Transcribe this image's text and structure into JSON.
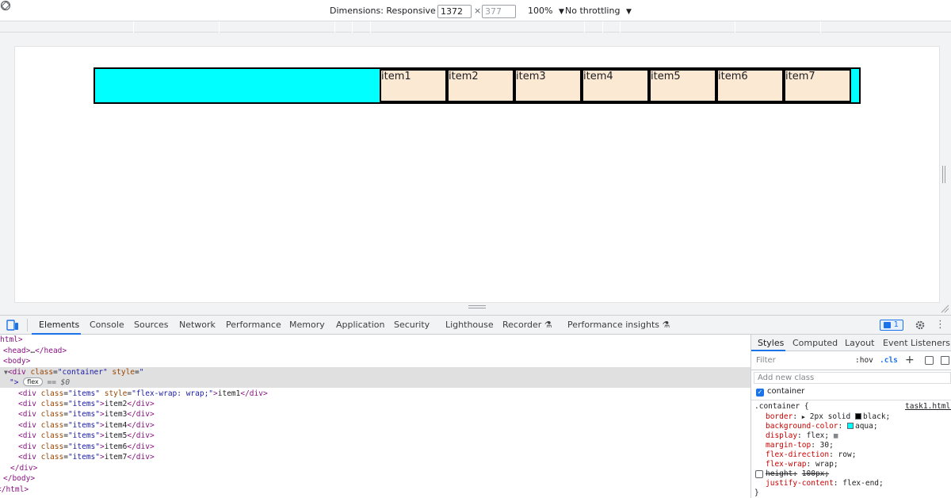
{
  "toolbar": {
    "dimensions_label": "Dimensions: Responsive",
    "width_value": "1372",
    "times": "×",
    "height_placeholder": "377",
    "zoom": "100%",
    "throttling": "No throttling",
    "caret": "▼"
  },
  "page": {
    "items": [
      "item1",
      "item2",
      "item3",
      "item4",
      "item5",
      "item6",
      "item7"
    ],
    "container_color": "#00ffff",
    "item_color": "#fbe9d4"
  },
  "devtools": {
    "tabs": [
      "Elements",
      "Console",
      "Sources",
      "Network",
      "Performance",
      "Memory",
      "Application",
      "Security",
      "Lighthouse",
      "Recorder",
      "Performance insights"
    ],
    "experimental_mark": "⚗",
    "issues_count": "1",
    "tree": {
      "l0": "html>",
      "l1_head_open": "<head>",
      "l1_head_ellipsis": "…",
      "l1_head_close": "</head>",
      "l2_body": "<body>",
      "l3_div_open": "<div ",
      "l3_attr_class": "class",
      "l3_eq1": "=",
      "l3_val_class": "\"container\"",
      "l3_attr_style": " style",
      "l3_eq2": "=",
      "l3_val_style_open": "\"",
      "l4_quote": "\">",
      "l4_badge": "flex",
      "l4_dollar": "== $0",
      "item1_open": "<div ",
      "item1_class": "class",
      "item1_classval": "\"items\"",
      "item1_style": " style",
      "item1_styleval": "\"flex-wrap: wrap;\"",
      "item1_gt": ">",
      "item_text": [
        "item1",
        "item2",
        "item3",
        "item4",
        "item5",
        "item6",
        "item7"
      ],
      "div_tag": "<div ",
      "class_attr": "class",
      "eq": "=",
      "items_val": "\"items\"",
      "gt": ">",
      "close_div": "</div>",
      "close_body": "</body>",
      "close_html": "</html>"
    },
    "styles_tabs": [
      "Styles",
      "Computed",
      "Layout",
      "Event Listeners"
    ],
    "filter_placeholder": "Filter",
    "hov": ":hov",
    "cls": ".cls",
    "add_class_placeholder": "Add new class",
    "class_checkbox_label": "container",
    "rule": {
      "selector": ".container {",
      "source": "task1.html:",
      "props": [
        {
          "name": "border",
          "colon": ":",
          "arrow": "▶",
          "value": "2px solid ",
          "swatch": "#000000",
          "value2": "black;"
        },
        {
          "name": "background-color",
          "colon": ":",
          "swatch": "#00ffff",
          "value": "aqua;"
        },
        {
          "name": "display",
          "colon": ":",
          "value": "flex;",
          "icon": "flex-grid-icon"
        },
        {
          "name": "margin-top",
          "colon": ":",
          "value": "30;"
        },
        {
          "name": "flex-direction",
          "colon": ":",
          "value": "row;"
        },
        {
          "name": "flex-wrap",
          "colon": ":",
          "value": "wrap;"
        },
        {
          "name": "height",
          "colon": ":",
          "value": "100px;",
          "disabled": true
        },
        {
          "name": "justify-content",
          "colon": ":",
          "value": "flex-end;"
        }
      ],
      "close": "}"
    }
  }
}
